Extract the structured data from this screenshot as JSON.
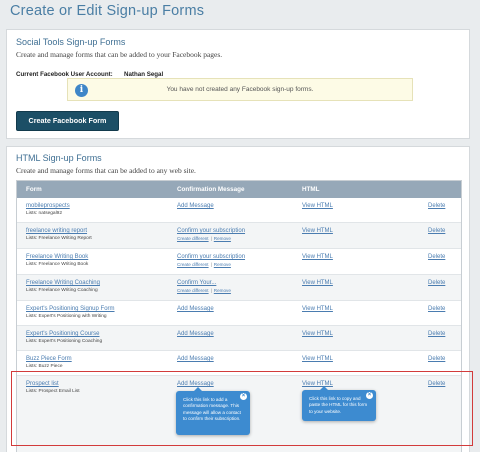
{
  "page": {
    "title": "Create or Edit Sign-up Forms"
  },
  "social": {
    "title": "Social Tools Sign-up Forms",
    "description": "Create and manage forms that can be added to your Facebook pages.",
    "account_label": "Current Facebook User Account:",
    "account_name": "Nathan Segal",
    "notice": "You have not created any Facebook sign-up forms.",
    "notice_icon": "info-icon",
    "create_button": "Create Facebook Form",
    "button_color": "#1c4f66"
  },
  "html_forms": {
    "title": "HTML Sign-up Forms",
    "description": "Create and manage forms that can be added to any web site.",
    "columns": {
      "form": "Form",
      "confirmation": "Confirmation Message",
      "html": "HTML"
    },
    "header_color": "#96a8b8",
    "link_color": "#4a7cb0",
    "rows": [
      {
        "name": "mobileprospects",
        "lists": "Lists:  natsegal92",
        "confirm": "Add Message",
        "create": "",
        "remove": "",
        "html": "View HTML",
        "delete": "Delete"
      },
      {
        "name": "freelance writing report",
        "lists": "Lists:  Freelance Writing Report",
        "confirm": "Confirm your subscription",
        "create": "Create different",
        "remove": "Remove",
        "html": "View HTML",
        "delete": "Delete"
      },
      {
        "name": "Freelance Writing Book",
        "lists": "Lists:  Freelance Writing Book",
        "confirm": "Confirm your subscription",
        "create": "Create different",
        "remove": "Remove",
        "html": "View HTML",
        "delete": "Delete"
      },
      {
        "name": "Freelance Writing Coaching",
        "lists": "Lists:  Freelance Writing Coaching",
        "confirm": "Confirm Your...",
        "create": "Create different",
        "remove": "Remove",
        "html": "View HTML",
        "delete": "Delete"
      },
      {
        "name": "Expert's Positioning Signup Form",
        "lists": "Lists:  Expert's Positioning with Writing",
        "confirm": "Add Message",
        "create": "",
        "remove": "",
        "html": "View HTML",
        "delete": "Delete"
      },
      {
        "name": "Expert's Positioning Course",
        "lists": "Lists:  Expert's Positioning Coaching",
        "confirm": "Add Message",
        "create": "",
        "remove": "",
        "html": "View HTML",
        "delete": "Delete"
      },
      {
        "name": "Buzz Piece Form",
        "lists": "Lists:  Buzz Piece",
        "confirm": "Add Message",
        "create": "",
        "remove": "",
        "html": "View HTML",
        "delete": "Delete"
      },
      {
        "name": "Prospect list",
        "lists": "Lists:  Prospect Email List",
        "confirm": "Add Message",
        "create": "",
        "remove": "",
        "html": "View HTML",
        "delete": "Delete"
      }
    ]
  },
  "tooltips": {
    "confirm": "Click this link to add a confirmation message. This message will allow a contact to confirm their subscription.",
    "html": "Click this link to copy and paste the HTML for this form to your website.",
    "close_icon": "close-icon",
    "color": "#3d8bd0"
  },
  "highlight_color": "#d23b3b"
}
